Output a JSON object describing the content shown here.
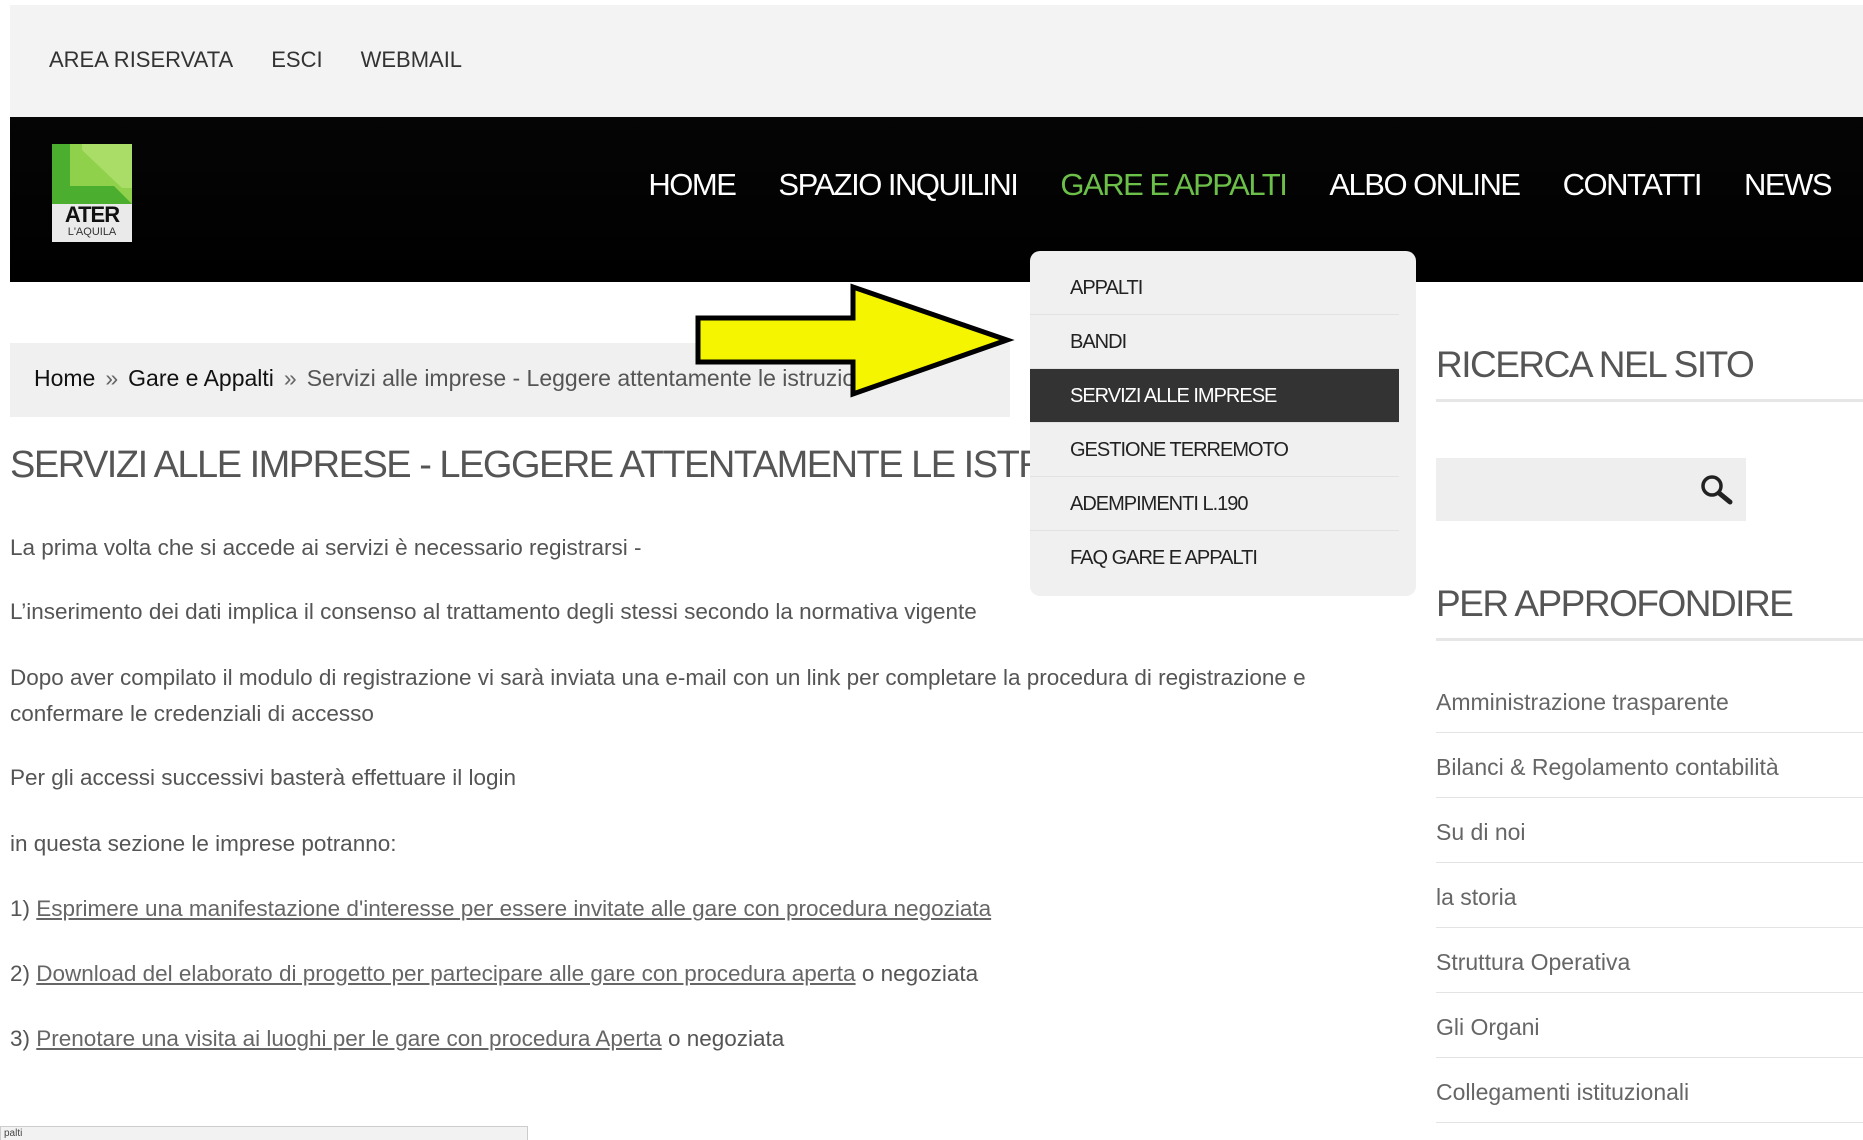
{
  "top_links": [
    "AREA RISERVATA",
    "ESCI",
    "WEBMAIL"
  ],
  "logo": {
    "text": "ATER",
    "sub": "L'AQUILA"
  },
  "main_nav": [
    "HOME",
    "SPAZIO INQUILINI",
    "GARE E APPALTI",
    "ALBO ONLINE",
    "CONTATTI",
    "NEWS"
  ],
  "dropdown": [
    "APPALTI",
    "BANDI",
    "SERVIZI ALLE IMPRESE",
    "GESTIONE TERREMOTO",
    "ADEMPIMENTI L.190",
    "FAQ GARE E APPALTI"
  ],
  "breadcrumb": {
    "home": "Home",
    "sep": "»",
    "section": "Gare e Appalti",
    "current": "Servizi alle imprese - Leggere attentamente le istruzioni"
  },
  "page_title": "SERVIZI ALLE IMPRESE - LEGGERE ATTENTAMENTE LE ISTRUZIONI",
  "content": {
    "p1": "La prima volta che si accede ai servizi è necessario registrarsi -",
    "p2": "L’inserimento dei dati implica il consenso al trattamento degli stessi secondo la normativa vigente",
    "p3a": "Dopo aver compilato il modulo di registrazione vi sarà inviata una e-mail con un link per completare la procedura di registrazione e",
    "p3b": "confermare le credenziali di accesso",
    "p4": "Per gli accessi successivi basterà effettuare il login",
    "p5": "in questa sezione le imprese potranno:",
    "i1_num": "1)",
    "i1_link": "Esprimere una manifestazione d'interesse per essere invitate alle gare con procedura negoziata",
    "i2_num": "2)",
    "i2_link": "Download del elaborato di progetto per partecipare alle gare con procedura aperta",
    "i2_tail": "o negoziata",
    "i3_num": "3)",
    "i3_link": "Prenotare una visita ai luoghi per le gare con procedura Aperta",
    "i3_tail": "o negoziata"
  },
  "sidebar": {
    "search_heading": "RICERCA NEL SITO",
    "more_heading": "PER APPROFONDIRE",
    "links": [
      "Amministrazione trasparente",
      "Bilanci & Regolamento contabilità",
      "Su di noi",
      "la storia",
      "Struttura Operativa",
      "Gli Organi",
      "Collegamenti istituzionali"
    ]
  },
  "status_bar": "palti",
  "colors": {
    "accent": "#6cc04a",
    "arrow": "#f5f500"
  }
}
